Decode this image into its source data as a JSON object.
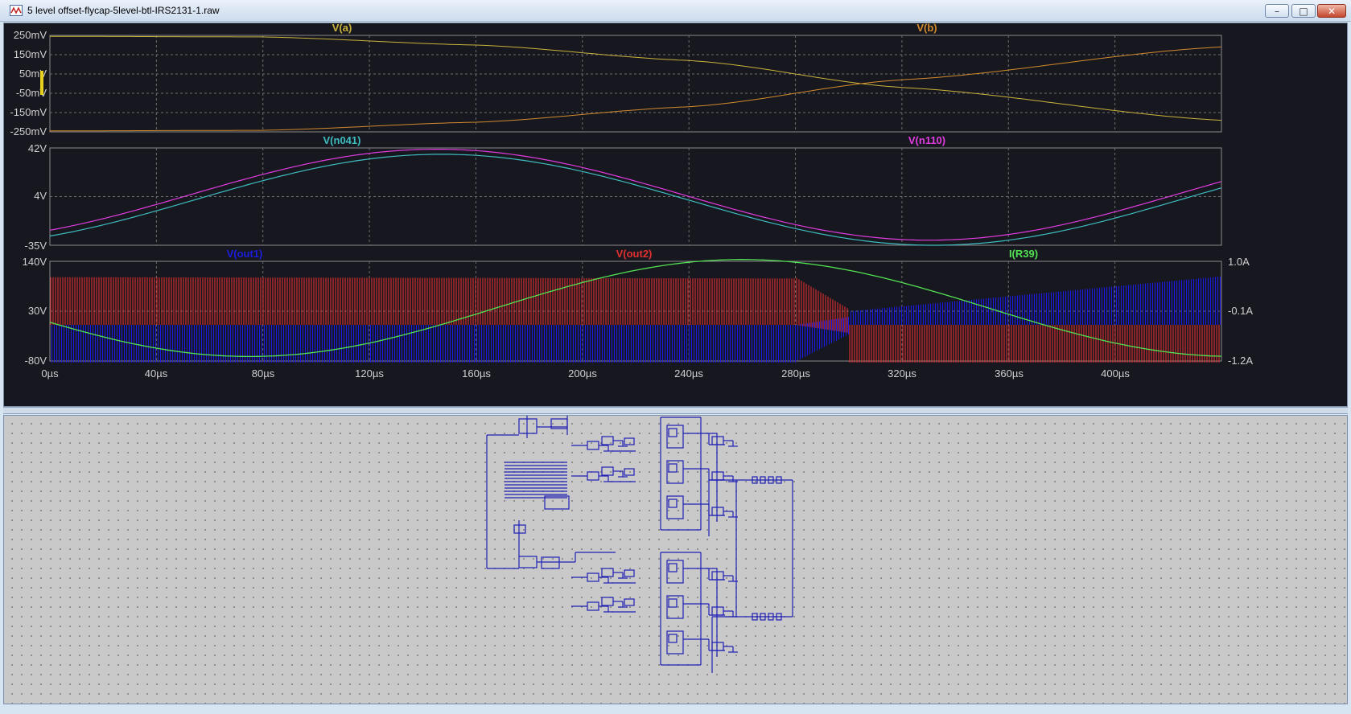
{
  "window": {
    "title": "5 level offset-flycap-5level-btl-IRS2131-1.raw",
    "icon": "ltspice-waveform-icon",
    "controls": {
      "minimize": "–",
      "maximize": "□",
      "close": "✕"
    }
  },
  "colors": {
    "plot_bg": "#171720",
    "grid": "#6d6d6d",
    "va": "#c9b33a",
    "vb": "#d28a2c",
    "vn041": "#3ebdc0",
    "vn110": "#e13ce0",
    "vout1": "#1c1ce0",
    "vout2": "#e23030",
    "ir39": "#52e252",
    "schematic_wire": "#1f1fb5"
  },
  "chart_data": [
    {
      "type": "line",
      "pane": "top",
      "series": [
        {
          "name": "V(a)",
          "color": "#c9b33a",
          "x": [
            0,
            80,
            160,
            240,
            320,
            440
          ],
          "y": [
            245,
            242,
            200,
            120,
            -20,
            -190
          ]
        },
        {
          "name": "V(b)",
          "color": "#d28a2c",
          "x": [
            0,
            80,
            160,
            240,
            320,
            440
          ],
          "y": [
            -245,
            -242,
            -200,
            -120,
            20,
            190
          ]
        }
      ],
      "ylim": [
        -250,
        250
      ],
      "yticks": [
        "250mV",
        "150mV",
        "50mV",
        "-50mV",
        "-150mV",
        "-250mV"
      ],
      "xlim": [
        0,
        440
      ],
      "grid": true
    },
    {
      "type": "line",
      "pane": "middle",
      "series": [
        {
          "name": "V(n041)",
          "color": "#3ebdc0"
        },
        {
          "name": "V(n110)",
          "color": "#e13ce0"
        }
      ],
      "ylim": [
        -35,
        42
      ],
      "yticks": [
        "42V",
        "4V",
        "-35V"
      ],
      "xlim": [
        0,
        440
      ],
      "grid": true
    },
    {
      "type": "line",
      "pane": "bottom",
      "series": [
        {
          "name": "V(out1)",
          "color": "#1c1ce0"
        },
        {
          "name": "V(out2)",
          "color": "#e23030"
        },
        {
          "name": "I(R39)",
          "color": "#52e252",
          "axis": "right"
        }
      ],
      "ylim": [
        -80,
        140
      ],
      "yticks": [
        "140V",
        "30V",
        "-80V"
      ],
      "y2lim": [
        -1.2,
        1.0
      ],
      "y2ticks": [
        "1.0A",
        "-0.1A",
        "-1.2A"
      ],
      "xlim": [
        0,
        440
      ],
      "xticks": [
        "0µs",
        "40µs",
        "80µs",
        "120µs",
        "160µs",
        "200µs",
        "240µs",
        "280µs",
        "320µs",
        "360µs",
        "400µs"
      ],
      "grid": true
    }
  ]
}
